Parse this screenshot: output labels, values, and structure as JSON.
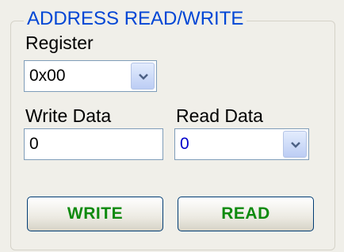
{
  "group": {
    "title": "ADDRESS READ/WRITE"
  },
  "register": {
    "label": "Register",
    "value": "0x00",
    "dropdown_icon": "chevron-down-icon"
  },
  "write_data": {
    "label": "Write Data",
    "value": "0"
  },
  "read_data": {
    "label": "Read Data",
    "value": "0",
    "value_color": "#0000cc",
    "dropdown_icon": "chevron-down-icon"
  },
  "buttons": {
    "write_label": "WRITE",
    "read_label": "READ",
    "text_color": "#0f8a0f"
  }
}
